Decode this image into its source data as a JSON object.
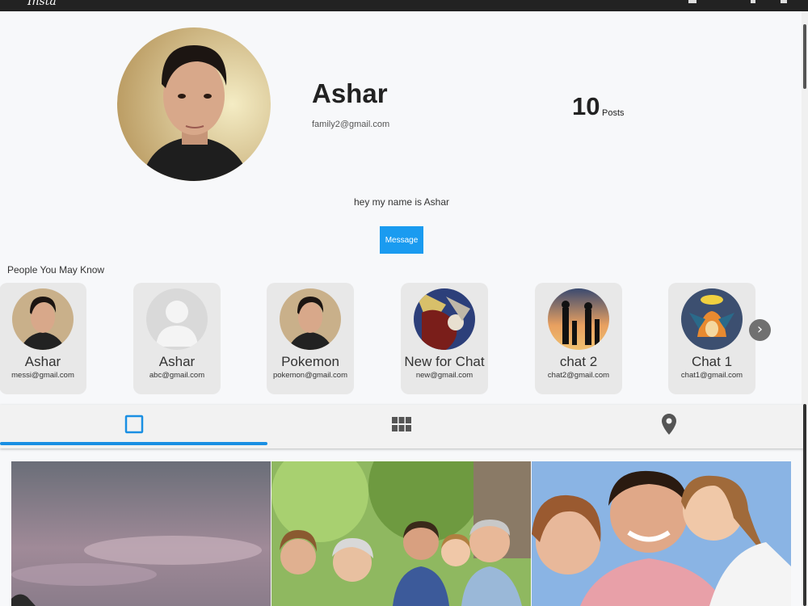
{
  "topbar": {
    "logo": "Insta",
    "icons": [
      "chat-icon",
      "heart-icon",
      "user-icon"
    ]
  },
  "profile": {
    "name": "Ashar",
    "email": "family2@gmail.com",
    "posts_count": "10",
    "posts_label": "Posts",
    "bio": "hey my name is Ashar",
    "message_button": "Message"
  },
  "people_you_may_know": {
    "title": "People You May Know",
    "people": [
      {
        "name": "Ashar",
        "email": "messi@gmail.com"
      },
      {
        "name": "Ashar",
        "email": "abc@gmail.com"
      },
      {
        "name": "Pokemon",
        "email": "pokemon@gmail.com"
      },
      {
        "name": "New for Chat",
        "email": "new@gmail.com"
      },
      {
        "name": "chat 2",
        "email": "chat2@gmail.com"
      },
      {
        "name": "Chat 1",
        "email": "chat1@gmail.com"
      }
    ],
    "next_icon": "chevron-right-icon"
  },
  "tabs": [
    {
      "icon": "square-icon",
      "active": true
    },
    {
      "icon": "grid-icon",
      "active": false
    },
    {
      "icon": "location-pin-icon",
      "active": false
    }
  ],
  "colors": {
    "accent": "#1a9bf0",
    "tab_indicator": "#1a8fe3",
    "topbar": "#222222",
    "card_bg": "#e8e8e8"
  }
}
